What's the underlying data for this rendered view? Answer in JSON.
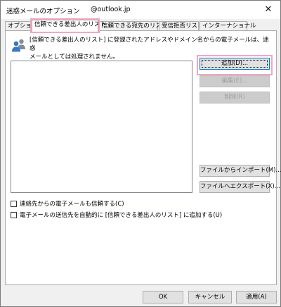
{
  "window": {
    "title": "迷惑メールのオプション",
    "account": "@outlook.jp",
    "close_glyph": "✕"
  },
  "tabs": [
    {
      "label": "オプション",
      "active": false
    },
    {
      "label": "信頼できる差出人のリスト",
      "active": true
    },
    {
      "label": "信頼できる宛先のリスト",
      "active": false
    },
    {
      "label": "受信拒否リスト",
      "active": false
    },
    {
      "label": "インターナショナル",
      "active": false
    }
  ],
  "panel": {
    "icon": "people-icon",
    "description_line1": "[信頼できる差出人のリスト] に登録されたアドレスやドメイン名からの電子メールは、迷惑",
    "description_line2": "メールとしては処理されません。"
  },
  "buttons": {
    "add": "追加(D)...",
    "edit": "編集(E)...",
    "delete": "削除(R)",
    "import": "ファイルからインポート(M)...",
    "export": "ファイルへエクスポート(X)..."
  },
  "checkboxes": [
    {
      "label": "連絡先からの電子メールも信頼する(C)",
      "checked": false
    },
    {
      "label": "電子メールの送信先を自動的に [信頼できる差出人のリスト] に追加する(U)",
      "checked": false
    }
  ],
  "footer": {
    "ok": "OK",
    "cancel": "キャンセル",
    "apply": "適用(A)"
  },
  "colors": {
    "highlight": "#f2a6c2",
    "focus_border": "#0078d7",
    "icon_blue": "#3b78c2",
    "icon_grey": "#7f8c99"
  }
}
